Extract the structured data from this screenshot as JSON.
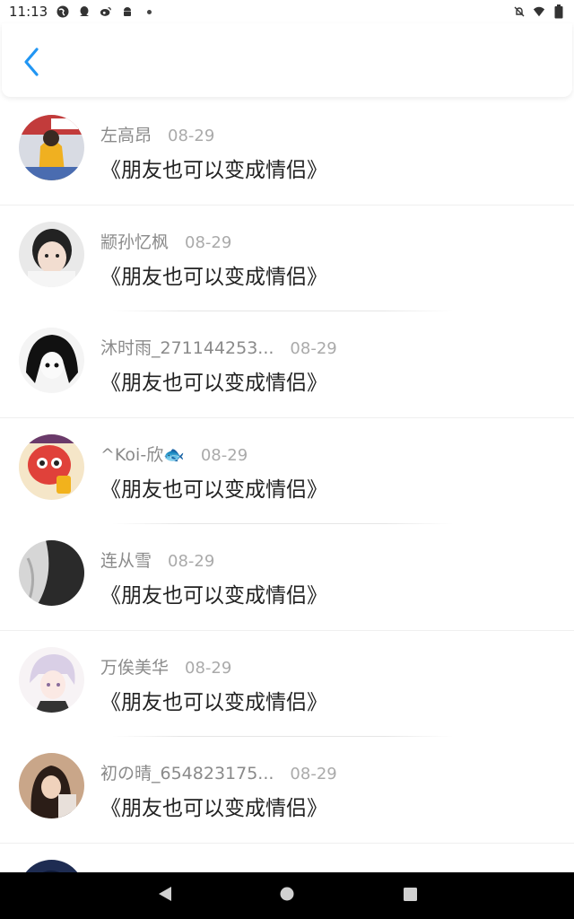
{
  "status_bar": {
    "time": "11:13",
    "left_icons": [
      "globe-icon",
      "qq-icon",
      "weibo-icon",
      "android-icon",
      "dot-icon"
    ],
    "right_icons": [
      "mute-bell-icon",
      "wifi-icon",
      "battery-icon"
    ]
  },
  "header": {
    "back_icon": "chevron-left-icon",
    "accent_color": "#2196F3"
  },
  "items": [
    {
      "name": "左高昂",
      "date": "08-29",
      "message": "《朋友也可以变成情侣》"
    },
    {
      "name": "颛孙忆枫",
      "date": "08-29",
      "message": "《朋友也可以变成情侣》"
    },
    {
      "name": "沐时雨_271144253...",
      "date": "08-29",
      "message": "《朋友也可以变成情侣》"
    },
    {
      "name": "^Koi-欣🐟",
      "date": "08-29",
      "message": "《朋友也可以变成情侣》"
    },
    {
      "name": "连从雪",
      "date": "08-29",
      "message": "《朋友也可以变成情侣》"
    },
    {
      "name": "万俟美华",
      "date": "08-29",
      "message": "《朋友也可以变成情侣》"
    },
    {
      "name": "初の晴_654823175...",
      "date": "08-29",
      "message": "《朋友也可以变成情侣》"
    },
    {
      "name": "",
      "date": "",
      "message": ""
    }
  ],
  "nav_bar": {
    "buttons": [
      "back-triangle-icon",
      "home-circle-icon",
      "recents-square-icon"
    ]
  }
}
